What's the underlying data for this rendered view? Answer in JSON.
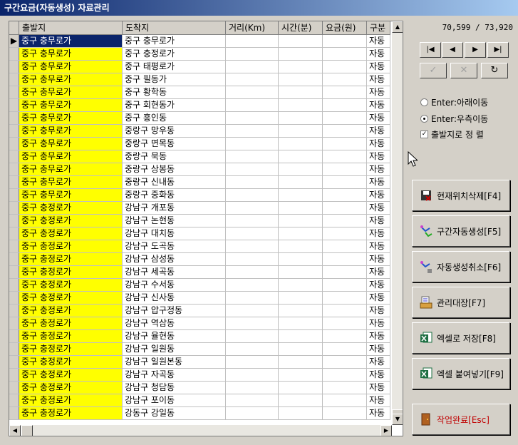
{
  "window": {
    "title": "구간요금(자동생성) 자료관리"
  },
  "grid": {
    "columns": [
      "출발지",
      "도착지",
      "거리(Km)",
      "시간(분)",
      "요금(원)",
      "구분"
    ],
    "rows": [
      [
        "중구 충무로가",
        "중구 충무로가",
        "",
        "",
        "",
        "자동"
      ],
      [
        "중구 충무로가",
        "중구 충정로가",
        "",
        "",
        "",
        "자동"
      ],
      [
        "중구 충무로가",
        "중구 태평로가",
        "",
        "",
        "",
        "자동"
      ],
      [
        "중구 충무로가",
        "중구 필동가",
        "",
        "",
        "",
        "자동"
      ],
      [
        "중구 충무로가",
        "중구 황학동",
        "",
        "",
        "",
        "자동"
      ],
      [
        "중구 충무로가",
        "중구 회현동가",
        "",
        "",
        "",
        "자동"
      ],
      [
        "중구 충무로가",
        "중구 흥인동",
        "",
        "",
        "",
        "자동"
      ],
      [
        "중구 충무로가",
        "중랑구 망우동",
        "",
        "",
        "",
        "자동"
      ],
      [
        "중구 충무로가",
        "중랑구 면목동",
        "",
        "",
        "",
        "자동"
      ],
      [
        "중구 충무로가",
        "중랑구 묵동",
        "",
        "",
        "",
        "자동"
      ],
      [
        "중구 충무로가",
        "중랑구 상봉동",
        "",
        "",
        "",
        "자동"
      ],
      [
        "중구 충무로가",
        "중랑구 신내동",
        "",
        "",
        "",
        "자동"
      ],
      [
        "중구 충무로가",
        "중랑구 중화동",
        "",
        "",
        "",
        "자동"
      ],
      [
        "중구 충정로가",
        "강남구 개포동",
        "",
        "",
        "",
        "자동"
      ],
      [
        "중구 충정로가",
        "강남구 논현동",
        "",
        "",
        "",
        "자동"
      ],
      [
        "중구 충정로가",
        "강남구 대치동",
        "",
        "",
        "",
        "자동"
      ],
      [
        "중구 충정로가",
        "강남구 도곡동",
        "",
        "",
        "",
        "자동"
      ],
      [
        "중구 충정로가",
        "강남구 삼성동",
        "",
        "",
        "",
        "자동"
      ],
      [
        "중구 충정로가",
        "강남구 세곡동",
        "",
        "",
        "",
        "자동"
      ],
      [
        "중구 충정로가",
        "강남구 수서동",
        "",
        "",
        "",
        "자동"
      ],
      [
        "중구 충정로가",
        "강남구 신사동",
        "",
        "",
        "",
        "자동"
      ],
      [
        "중구 충정로가",
        "강남구 압구정동",
        "",
        "",
        "",
        "자동"
      ],
      [
        "중구 충정로가",
        "강남구 역삼동",
        "",
        "",
        "",
        "자동"
      ],
      [
        "중구 충정로가",
        "강남구 율현동",
        "",
        "",
        "",
        "자동"
      ],
      [
        "중구 충정로가",
        "강남구 일원동",
        "",
        "",
        "",
        "자동"
      ],
      [
        "중구 충정로가",
        "강남구 일원본동",
        "",
        "",
        "",
        "자동"
      ],
      [
        "중구 충정로가",
        "강남구 자곡동",
        "",
        "",
        "",
        "자동"
      ],
      [
        "중구 충정로가",
        "강남구 청담동",
        "",
        "",
        "",
        "자동"
      ],
      [
        "중구 충정로가",
        "강남구 포이동",
        "",
        "",
        "",
        "자동"
      ],
      [
        "중구 충정로가",
        "강동구 강일동",
        "",
        "",
        "",
        "자동"
      ]
    ]
  },
  "counter": "70,599 / 73,920",
  "options": {
    "enter_down": "Enter:아래이동",
    "enter_right": "Enter:우측이동",
    "sort_by_origin": "출발지로 정 렬"
  },
  "buttons": {
    "delete": "현재위치삭제[F4]",
    "generate": "구간자동생성[F5]",
    "cancel_generate": "자동생성취소[F6]",
    "ledger": "관리대장[F7]",
    "save_excel": "엑셀로 저장[F8]",
    "paste_excel": "엑셀 붙여넣기[F9]",
    "done": "작업완료[Esc]"
  },
  "colors": {
    "origin_bg": "#ffff00",
    "selected": "#0a246a",
    "title": "#0a246a"
  }
}
